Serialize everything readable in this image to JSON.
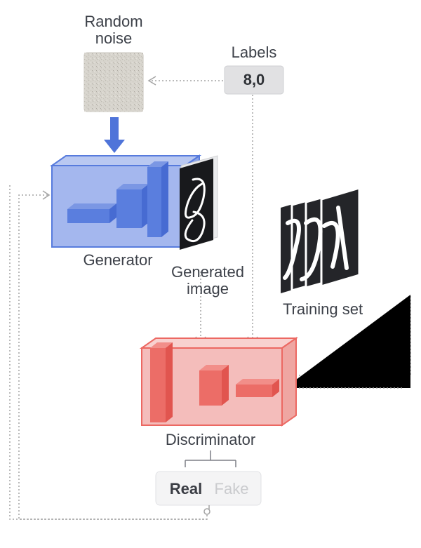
{
  "random_noise_label": "Random",
  "random_noise_label2": "noise",
  "labels_title": "Labels",
  "labels_value": "8,0",
  "training_set_label": "Training set",
  "generator_label": "Generator",
  "generated_label1": "Generated",
  "generated_label2": "image",
  "discriminator_label": "Discriminator",
  "real_label": "Real",
  "fake_label": "Fake",
  "colors": {
    "arrow_blue": "#4f74d9",
    "gen_fill": "#a4b7ee",
    "gen_stroke": "#577bdd",
    "gen_bar": "#5a7ede",
    "disc_fill": "#f4bdbb",
    "disc_stroke": "#ec6862",
    "box_grey": "#eeeef0",
    "box_stroke": "#d4d5d8",
    "dark": "#242529"
  }
}
